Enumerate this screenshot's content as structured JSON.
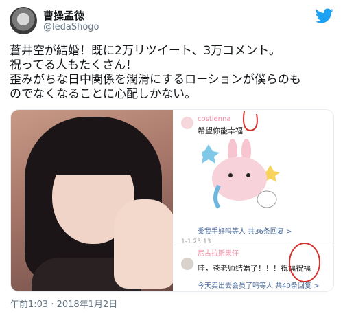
{
  "author": {
    "name": "曹操孟徳",
    "handle": "@ledaShogo"
  },
  "tweet": {
    "text": "蒼井空が結婚！既に2万リツイート、3万コメント。\n祝ってる人もたくさん！\n歪みがちな日中関係を潤滑にするローションが僕らのも\nのでなくなることに心配しかない。",
    "timestamp": "午前1:03 · 2018年1月2日"
  },
  "screenshot": {
    "comment1": {
      "username": "costienna",
      "text": "希望你能幸福",
      "replies_link": "黍我手好吗等人  共36条回复 >",
      "time": "1-1 23:13"
    },
    "comment2": {
      "username": "尼古拉斯果仔",
      "text": "哇，苍老师结婚了！！！祝福祝福",
      "replies_link": "今天卖出去会员了吗等人  共40条回复 >"
    }
  },
  "colors": {
    "twitter_blue": "#1da1f2",
    "text": "#14171a",
    "muted": "#657786",
    "weibo_pink": "#f48aa5",
    "weibo_link": "#4a6b9e",
    "annotation_red": "#d6322f"
  },
  "icons": [
    "twitter-bird-icon"
  ]
}
